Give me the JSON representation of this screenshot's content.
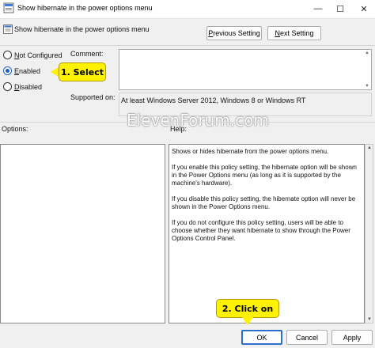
{
  "window": {
    "title": "Show hibernate in the power options menu",
    "controls": {
      "minimize": "—",
      "maximize": "☐",
      "close": "✕"
    }
  },
  "header": {
    "setting_title": "Show hibernate in the power options menu",
    "prev_button": {
      "pre": "",
      "key": "P",
      "post": "revious Setting"
    },
    "next_button": {
      "pre": "",
      "key": "N",
      "post": "ext Setting"
    }
  },
  "state_options": [
    {
      "pre": "",
      "key": "N",
      "post": "ot Configured",
      "selected": false
    },
    {
      "pre": "",
      "key": "E",
      "post": "nabled",
      "selected": true
    },
    {
      "pre": "",
      "key": "D",
      "post": "isabled",
      "selected": false
    }
  ],
  "comment": {
    "label": "Comment:",
    "value": ""
  },
  "supported_on": {
    "label": "Supported on:",
    "value": "At least Windows Server 2012, Windows 8 or Windows RT"
  },
  "watermark": "ElevenForum.com",
  "options_pane": {
    "label": "Options:"
  },
  "help_pane": {
    "label": "Help:",
    "paragraphs": [
      "Shows or hides hibernate from the power options menu.",
      "If you enable this policy setting, the hibernate option will be shown in the Power Options menu (as long as it is supported by the machine's hardware).",
      "If you disable this policy setting, the hibernate option will never be shown in the Power Options menu.",
      "If you do not configure this policy setting, users will be able to choose whether they want hibernate to show through the Power Options Control Panel."
    ]
  },
  "callouts": {
    "select": "1. Select",
    "click_on": "2. Click on"
  },
  "footer": {
    "ok": "OK",
    "cancel": "Cancel",
    "apply": "Apply"
  },
  "colors": {
    "callout": "#fff200",
    "accent": "#1f5fbf",
    "window_bg": "#f0f0f0"
  }
}
